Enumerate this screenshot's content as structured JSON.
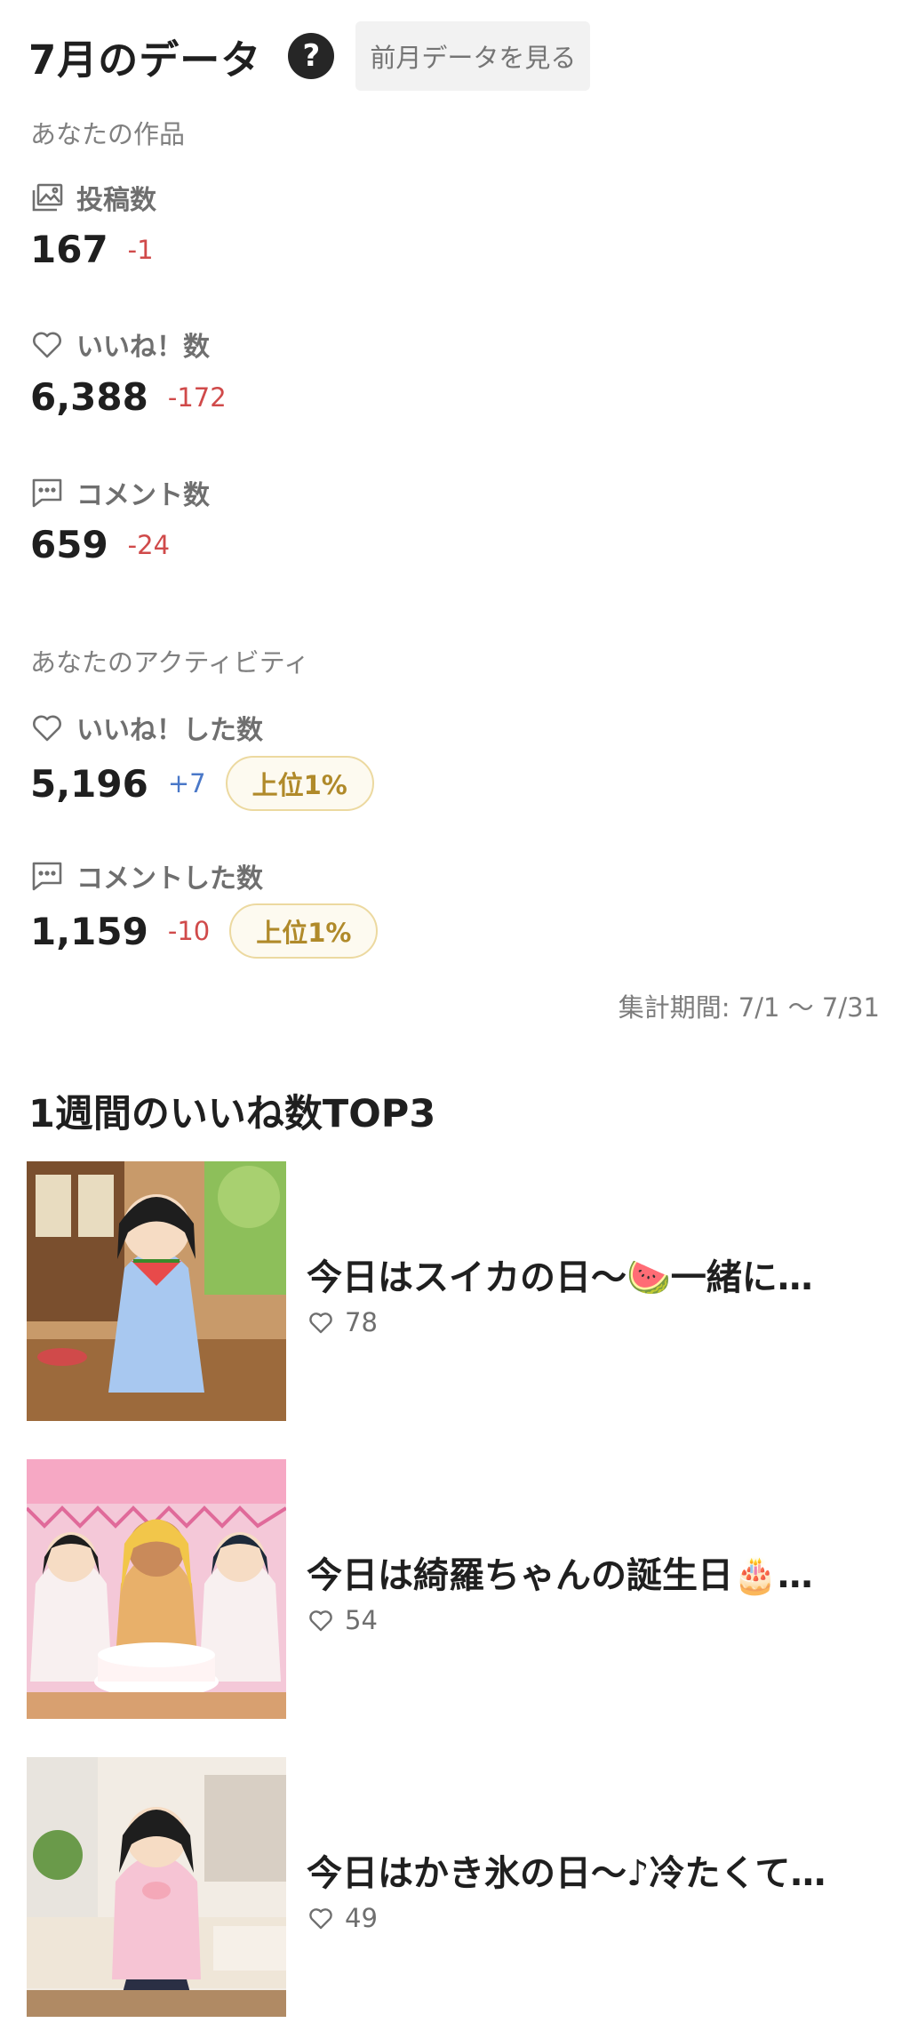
{
  "header": {
    "title": "7月のデータ",
    "help_icon": "?",
    "prev_month_label": "前月データを見る"
  },
  "your_works": {
    "section_label": "あなたの作品",
    "posts": {
      "label": "投稿数",
      "icon": "image-stack-icon",
      "value": "167",
      "delta": "-1"
    },
    "likes": {
      "label": "いいね！数",
      "icon": "heart-icon",
      "value": "6,388",
      "delta": "-172"
    },
    "comments": {
      "label": "コメント数",
      "icon": "comment-icon",
      "value": "659",
      "delta": "-24"
    }
  },
  "your_activity": {
    "section_label": "あなたのアクティビティ",
    "likes_given": {
      "label": "いいね！した数",
      "icon": "heart-icon",
      "value": "5,196",
      "delta": "+7",
      "rank": "上位1%"
    },
    "comments_given": {
      "label": "コメントした数",
      "icon": "comment-icon",
      "value": "1,159",
      "delta": "-10",
      "rank": "上位1%"
    }
  },
  "period": "集計期間: 7/1 〜 7/31",
  "top3": {
    "title": "1週間のいいね数TOP3",
    "items": [
      {
        "title": "今日はスイカの日〜🍉一緒に…",
        "likes": "78"
      },
      {
        "title": "今日は綺羅ちゃんの誕生日🎂…",
        "likes": "54"
      },
      {
        "title": "今日はかき氷の日〜♪冷たくて…",
        "likes": "49"
      }
    ]
  },
  "colors": {
    "negative": "#d04a4a",
    "positive": "#4a78c8",
    "badge": "#b08a2a"
  }
}
